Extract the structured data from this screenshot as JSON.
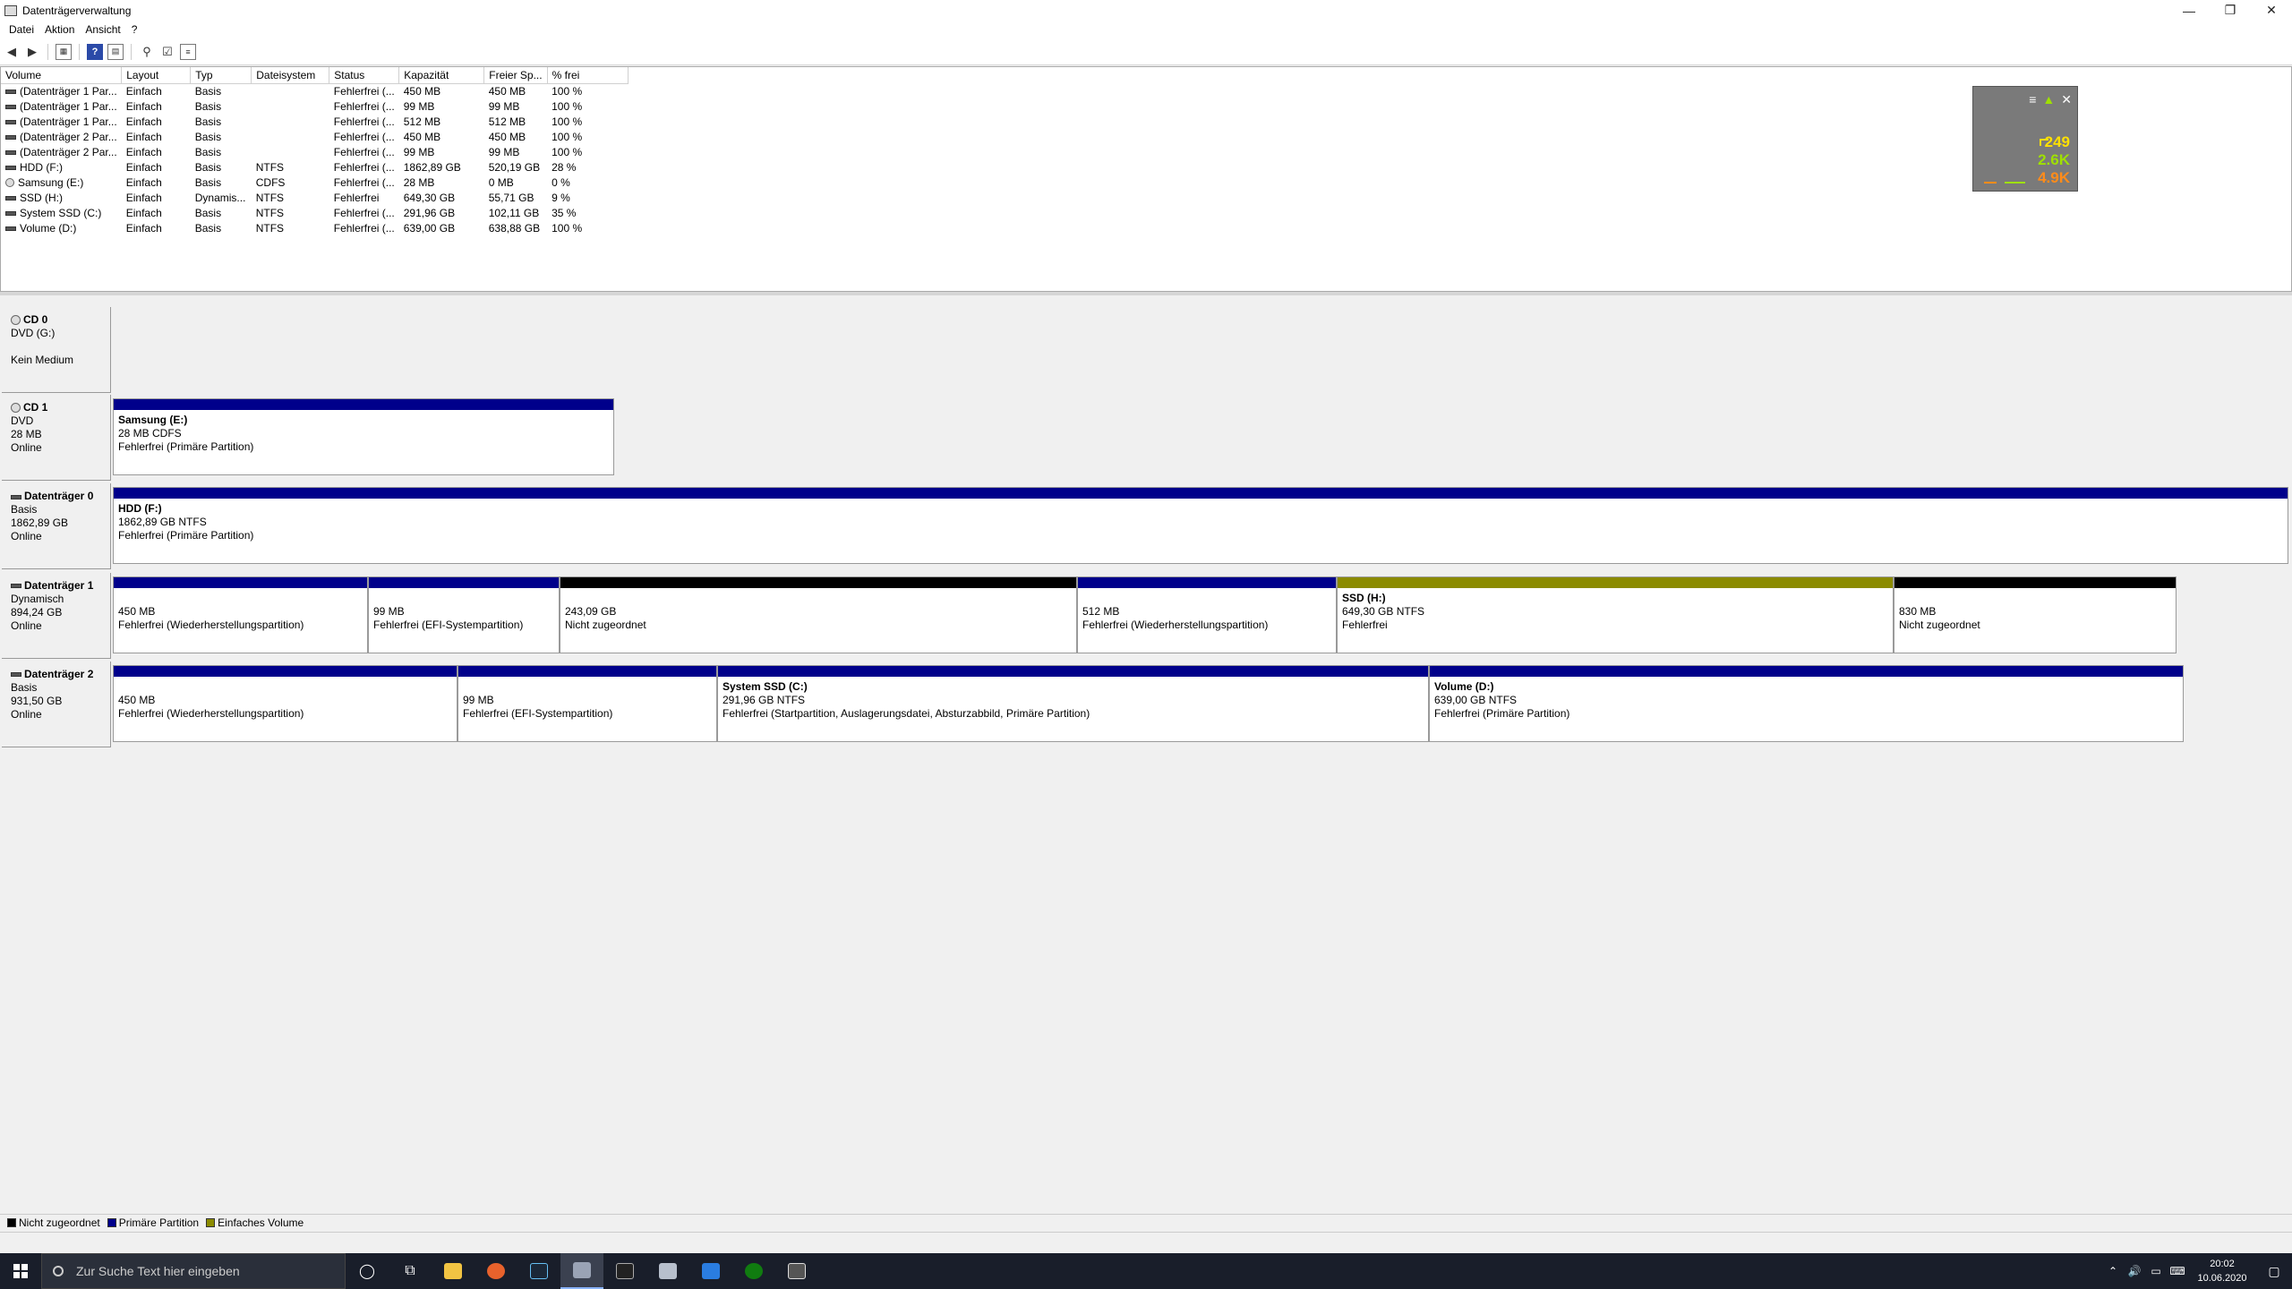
{
  "window": {
    "title": "Datenträgerverwaltung",
    "buttons": [
      "—",
      "❐",
      "✕"
    ]
  },
  "menu": [
    "Datei",
    "Aktion",
    "Ansicht",
    "?"
  ],
  "volume_table": {
    "headers": [
      "Volume",
      "Layout",
      "Typ",
      "Dateisystem",
      "Status",
      "Kapazität",
      "Freier Sp...",
      "% frei"
    ],
    "rows": [
      {
        "volume": "(Datenträger 1 Par...",
        "layout": "Einfach",
        "typ": "Basis",
        "fs": "",
        "status": "Fehlerfrei (...",
        "cap": "450 MB",
        "free": "450 MB",
        "pct": "100 %",
        "icon": "disk"
      },
      {
        "volume": "(Datenträger 1 Par...",
        "layout": "Einfach",
        "typ": "Basis",
        "fs": "",
        "status": "Fehlerfrei (...",
        "cap": "99 MB",
        "free": "99 MB",
        "pct": "100 %",
        "icon": "disk"
      },
      {
        "volume": "(Datenträger 1 Par...",
        "layout": "Einfach",
        "typ": "Basis",
        "fs": "",
        "status": "Fehlerfrei (...",
        "cap": "512 MB",
        "free": "512 MB",
        "pct": "100 %",
        "icon": "disk"
      },
      {
        "volume": "(Datenträger 2 Par...",
        "layout": "Einfach",
        "typ": "Basis",
        "fs": "",
        "status": "Fehlerfrei (...",
        "cap": "450 MB",
        "free": "450 MB",
        "pct": "100 %",
        "icon": "disk"
      },
      {
        "volume": "(Datenträger 2 Par...",
        "layout": "Einfach",
        "typ": "Basis",
        "fs": "",
        "status": "Fehlerfrei (...",
        "cap": "99 MB",
        "free": "99 MB",
        "pct": "100 %",
        "icon": "disk"
      },
      {
        "volume": "HDD (F:)",
        "layout": "Einfach",
        "typ": "Basis",
        "fs": "NTFS",
        "status": "Fehlerfrei (...",
        "cap": "1862,89 GB",
        "free": "520,19 GB",
        "pct": "28 %",
        "icon": "disk"
      },
      {
        "volume": "Samsung (E:)",
        "layout": "Einfach",
        "typ": "Basis",
        "fs": "CDFS",
        "status": "Fehlerfrei (...",
        "cap": "28 MB",
        "free": "0 MB",
        "pct": "0 %",
        "icon": "cd"
      },
      {
        "volume": "SSD (H:)",
        "layout": "Einfach",
        "typ": "Dynamis...",
        "fs": "NTFS",
        "status": "Fehlerfrei",
        "cap": "649,30 GB",
        "free": "55,71 GB",
        "pct": "9 %",
        "icon": "disk"
      },
      {
        "volume": "System SSD (C:)",
        "layout": "Einfach",
        "typ": "Basis",
        "fs": "NTFS",
        "status": "Fehlerfrei (...",
        "cap": "291,96 GB",
        "free": "102,11 GB",
        "pct": "35 %",
        "icon": "disk"
      },
      {
        "volume": "Volume (D:)",
        "layout": "Einfach",
        "typ": "Basis",
        "fs": "NTFS",
        "status": "Fehlerfrei (...",
        "cap": "639,00 GB",
        "free": "638,88 GB",
        "pct": "100 %",
        "icon": "disk"
      }
    ]
  },
  "widget": {
    "v1": "249",
    "v2": "2.6K",
    "v3": "4.9K"
  },
  "disks": [
    {
      "name": "CD 0",
      "line2": "DVD (G:)",
      "line3": "",
      "line4": "Kein Medium",
      "icon": "cd",
      "partitions": []
    },
    {
      "name": "CD 1",
      "line2": "DVD",
      "line3": "28 MB",
      "line4": "Online",
      "icon": "cd",
      "partitions": [
        {
          "name": "Samsung  (E:)",
          "size": "28 MB CDFS",
          "status": "Fehlerfrei (Primäre Partition)",
          "color": "#00008b",
          "w": 560
        }
      ]
    },
    {
      "name": "Datenträger 0",
      "line2": "Basis",
      "line3": "1862,89 GB",
      "line4": "Online",
      "icon": "disk",
      "partitions": [
        {
          "name": "HDD  (F:)",
          "size": "1862,89 GB NTFS",
          "status": "Fehlerfrei (Primäre Partition)",
          "color": "#00008b",
          "w": 2430
        }
      ]
    },
    {
      "name": "Datenträger 1",
      "line2": "Dynamisch",
      "line3": "894,24 GB",
      "line4": "Online",
      "icon": "disk",
      "partitions": [
        {
          "name": "",
          "size": "450 MB",
          "status": "Fehlerfrei (Wiederherstellungspartition)",
          "color": "#00008b",
          "w": 285
        },
        {
          "name": "",
          "size": "99 MB",
          "status": "Fehlerfrei (EFI-Systempartition)",
          "color": "#00008b",
          "w": 214
        },
        {
          "name": "",
          "size": "243,09 GB",
          "status": "Nicht zugeordnet",
          "color": "#000000",
          "w": 578
        },
        {
          "name": "",
          "size": "512 MB",
          "status": "Fehlerfrei (Wiederherstellungspartition)",
          "color": "#00008b",
          "w": 290
        },
        {
          "name": "SSD  (H:)",
          "size": "649,30 GB NTFS",
          "status": "Fehlerfrei",
          "color": "#8b8b00",
          "w": 622
        },
        {
          "name": "",
          "size": "830 MB",
          "status": "Nicht zugeordnet",
          "color": "#000000",
          "w": 316
        }
      ]
    },
    {
      "name": "Datenträger 2",
      "line2": "Basis",
      "line3": "931,50 GB",
      "line4": "Online",
      "icon": "disk",
      "partitions": [
        {
          "name": "",
          "size": "450 MB",
          "status": "Fehlerfrei (Wiederherstellungspartition)",
          "color": "#00008b",
          "w": 385
        },
        {
          "name": "",
          "size": "99 MB",
          "status": "Fehlerfrei (EFI-Systempartition)",
          "color": "#00008b",
          "w": 290
        },
        {
          "name": "System SSD  (C:)",
          "size": "291,96 GB NTFS",
          "status": "Fehlerfrei (Startpartition, Auslagerungsdatei, Absturzabbild, Primäre Partition)",
          "color": "#00008b",
          "w": 795
        },
        {
          "name": "Volume  (D:)",
          "size": "639,00 GB NTFS",
          "status": "Fehlerfrei (Primäre Partition)",
          "color": "#00008b",
          "w": 843
        }
      ]
    }
  ],
  "legend": [
    {
      "label": "Nicht zugeordnet",
      "color": "#000000"
    },
    {
      "label": "Primäre Partition",
      "color": "#00008b"
    },
    {
      "label": "Einfaches Volume",
      "color": "#8b8b00"
    }
  ],
  "taskbar": {
    "search_placeholder": "Zur Suche Text hier eingeben",
    "time": "20:02",
    "date": "10.06.2020"
  }
}
